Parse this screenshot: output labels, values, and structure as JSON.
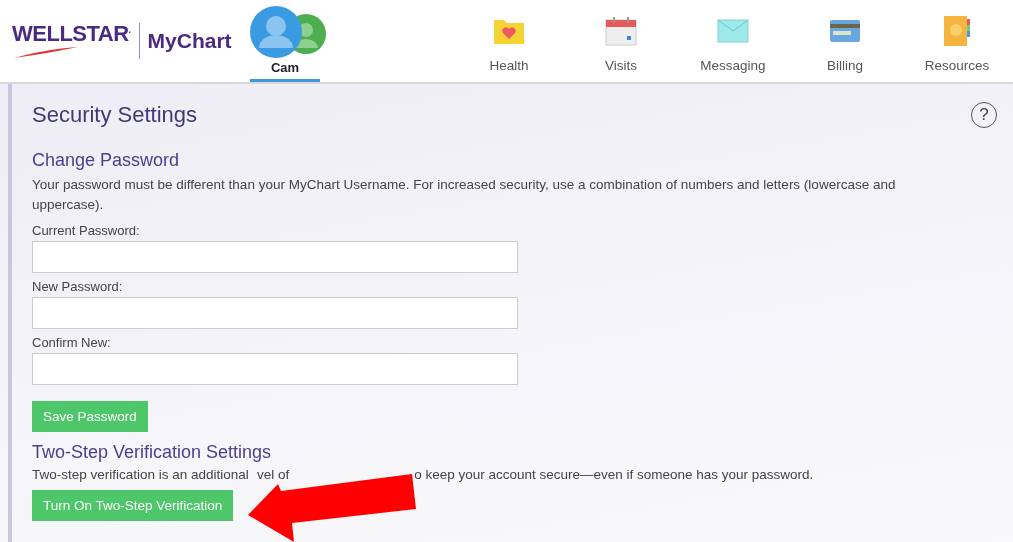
{
  "header": {
    "logo": {
      "brand": "WELLSTAR",
      "reg": ".",
      "product": "MyChart"
    },
    "account": {
      "name": "Cam",
      "selected": true
    },
    "nav": [
      {
        "label": "Health",
        "kind": "folder"
      },
      {
        "label": "Visits",
        "kind": "calendar"
      },
      {
        "label": "Messaging",
        "kind": "envelope"
      },
      {
        "label": "Billing",
        "kind": "card"
      },
      {
        "label": "Resources",
        "kind": "book"
      }
    ]
  },
  "page": {
    "title": "Security Settings",
    "help": "?",
    "password": {
      "heading": "Change Password",
      "text": "Your password must be different than your MyChart Username. For increased security, use a combination of numbers and letters (lowercase and uppercase).",
      "fields": [
        {
          "label": "Current Password:"
        },
        {
          "label": "New Password:"
        },
        {
          "label": "Confirm New:"
        }
      ],
      "button": "Save Password"
    },
    "two_step": {
      "heading": "Two-Step Verification Settings",
      "text_parts": [
        "Two-step verification is an additional",
        "vel of",
        "o keep your account secure—even if someone has your password."
      ],
      "button": "Turn On Two-Step Verification"
    }
  }
}
